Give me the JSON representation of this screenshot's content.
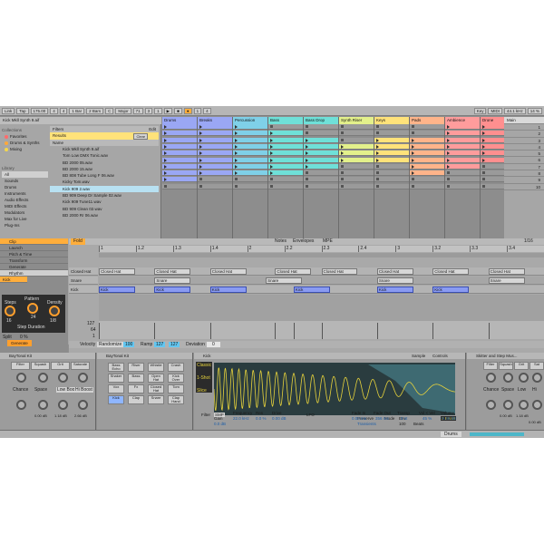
{
  "toolbar": {
    "link": "Link",
    "tap": "Tap",
    "tempo": "175.00",
    "sig_num": "4",
    "sig_den": "4",
    "metro": "1 Bar",
    "quant": "2 Bars",
    "scale_key": "C",
    "scale_name": "Major",
    "pos_bar": "71",
    "pos_beat": "3",
    "pos_sub": "1",
    "loop_start": "1",
    "loop_len": "4",
    "key": "Key",
    "midi": "MIDI",
    "sample_rate": "44.1 kHz",
    "cpu": "14 %"
  },
  "browser": {
    "header": "Kick Mkll Synth 9.aif",
    "collections_title": "Collections",
    "collections": [
      {
        "label": "Favorites",
        "color": "#ff6b6b"
      },
      {
        "label": "Drums & Synths",
        "color": "#ffa83a"
      },
      {
        "label": "Mixing",
        "color": "#f6d84a"
      }
    ],
    "library_title": "Library",
    "library": [
      "All",
      "Sounds",
      "Drums",
      "Instruments",
      "Audio Effects",
      "MIDI Effects",
      "Modulators",
      "Max for Live",
      "Plug-Ins"
    ],
    "filters_label": "Filters",
    "edit_label": "Edit",
    "results_label": "Results",
    "clear_label": "Clear",
    "name_header": "Name",
    "files": [
      "Kick Mkll Synth 9.aif",
      "Tom Low DMX Tonic.wav",
      "BD 2000 05.wav",
      "BD 2000 15.wav",
      "BD 808 Tube Long F 06.wav",
      "Kicky Tom.wav",
      "Kick 909 2.wav",
      "BD 909 Deep Dr Sample 02.wav",
      "Kick 909 Tune11.wav",
      "BD 909 Clean 02.wav",
      "BD 2000 Rr 06.wav"
    ]
  },
  "tracks": [
    {
      "name": "Drums",
      "color": "#9aa7f4"
    },
    {
      "name": "Breaks",
      "color": "#9aa7f4"
    },
    {
      "name": "Percussion",
      "color": "#7fd0e8"
    },
    {
      "name": "Bass",
      "color": "#6fe0d8"
    },
    {
      "name": "Bass Drop",
      "color": "#6fe0d8"
    },
    {
      "name": "Synth Riser",
      "color": "#e3f08b"
    },
    {
      "name": "Keys",
      "color": "#ffe27a"
    },
    {
      "name": "Pads",
      "color": "#ffb48a"
    },
    {
      "name": "Ambience",
      "color": "#ff9c9c"
    },
    {
      "name": "Drone",
      "color": "#ff8f8f"
    }
  ],
  "master": {
    "name": "Main",
    "scenes": [
      "1",
      "2",
      "3",
      "4",
      "5",
      "6",
      "7",
      "8",
      "9",
      "10"
    ]
  },
  "detail": {
    "clip_label": "Clip",
    "sections": [
      "Clip",
      "Launch",
      "Pitch & Time",
      "Transform",
      "Generate"
    ],
    "generator": "Rhythm",
    "instrument": "Kick",
    "steps_label": "Steps",
    "pattern_label": "Pattern",
    "density_label": "Density",
    "steps_value": "16",
    "pattern_value": "24",
    "density_value": "1/8",
    "step_duration_label": "Step Duration",
    "split_label": "Split",
    "split_value": "0 %",
    "vel_a": "100",
    "vel_b": "127",
    "vel_c": "Freq",
    "generate_label": "Generate",
    "fold": "Fold",
    "tabs": [
      "Notes",
      "Envelopes",
      "MPE"
    ],
    "grid": "1/16",
    "bars": [
      "1",
      "1.2",
      "1.3",
      "1.4",
      "2",
      "2.2",
      "2.3",
      "2.4",
      "3",
      "3.2",
      "3.3",
      "3.4"
    ],
    "lanes": [
      "Closed Hat",
      "Snare",
      "Kick"
    ],
    "vel_top": "127",
    "vel_mid": "64",
    "vel_bot": "1",
    "velocity_label": "Velocity",
    "randomize_label": "Randomize",
    "vel_val": "100",
    "ramp_label": "Ramp",
    "ramp_a": "127",
    "ramp_b": "127",
    "deviation_label": "Deviation",
    "deviation_val": "0"
  },
  "devices": {
    "kit1": {
      "title": "BayTonal Kit",
      "tabs": [
        "Filter",
        "Squash",
        "Grit",
        "Saturate"
      ],
      "knobs": [
        "Chance",
        "Space",
        "Low Boost",
        "Hi Boost"
      ],
      "values": [
        "0.00 dB",
        "1.18 dB",
        "2.66 dB"
      ]
    },
    "kit2": {
      "title": "BayTonal Kit",
      "pads": [
        "Bass Echo",
        "Riser",
        "Whistle",
        "Crash",
        "Shaker",
        "Bass",
        "Open Hat",
        "Kick Over",
        "Vox",
        "Fx",
        "Closed Hat",
        "Tom",
        "Kick",
        "Clap",
        "Snare",
        "Clap Hand"
      ]
    },
    "sampler": {
      "title": "Kick",
      "modes": [
        "Classic",
        "1-Shot",
        "Slice"
      ],
      "sample_label": "Sample",
      "controls_label": "Controls",
      "gain_label": "Gain",
      "gain_value": "0.0 dB",
      "warp_label": "Warp",
      "preserve_label": "Preserve",
      "preserve_value": "Transients",
      "mode_label": "Mode",
      "env_label": "Env",
      "env_value": "100",
      "beats_label": "Beats",
      "beats_value": "2 Beats",
      "filter_label": "Filter",
      "filter_type": "SMP",
      "frequency_label": "Frequency",
      "frequency_value": "22.0 kHz",
      "res_label": "Res",
      "res_value": "0.0 %",
      "drive_label": "Drive",
      "drive_value": "0.00 dB",
      "lfo_label": "LFO",
      "fade_in_label": "Fade In",
      "fade_in_value": "0.00 ms",
      "fade_out_label": "Fade Out",
      "fade_out_value": "356 ms",
      "transp_label": "Transp",
      "transp_value": "0 st",
      "vol_vel_label": "Vol < Vel",
      "vol_vel_value": "45 %",
      "volume_label": "Volume",
      "volume_value": "-5.36 dB"
    },
    "fx": {
      "title": "Skitter and Step Mus...",
      "tabs": [
        "Filter",
        "Squash",
        "Grit",
        "Sat"
      ],
      "knobs": [
        "Chance",
        "Space",
        "Low",
        "Hi"
      ],
      "values": [
        "0.00 dB",
        "1.18 dB",
        "0.00 dB"
      ]
    }
  },
  "footer": {
    "track": "Drums"
  },
  "colors": {
    "accent": "#ff9f2d",
    "selection": "#b8e1f2",
    "note": "#7f8ef0",
    "wave": "#e6d23c"
  }
}
